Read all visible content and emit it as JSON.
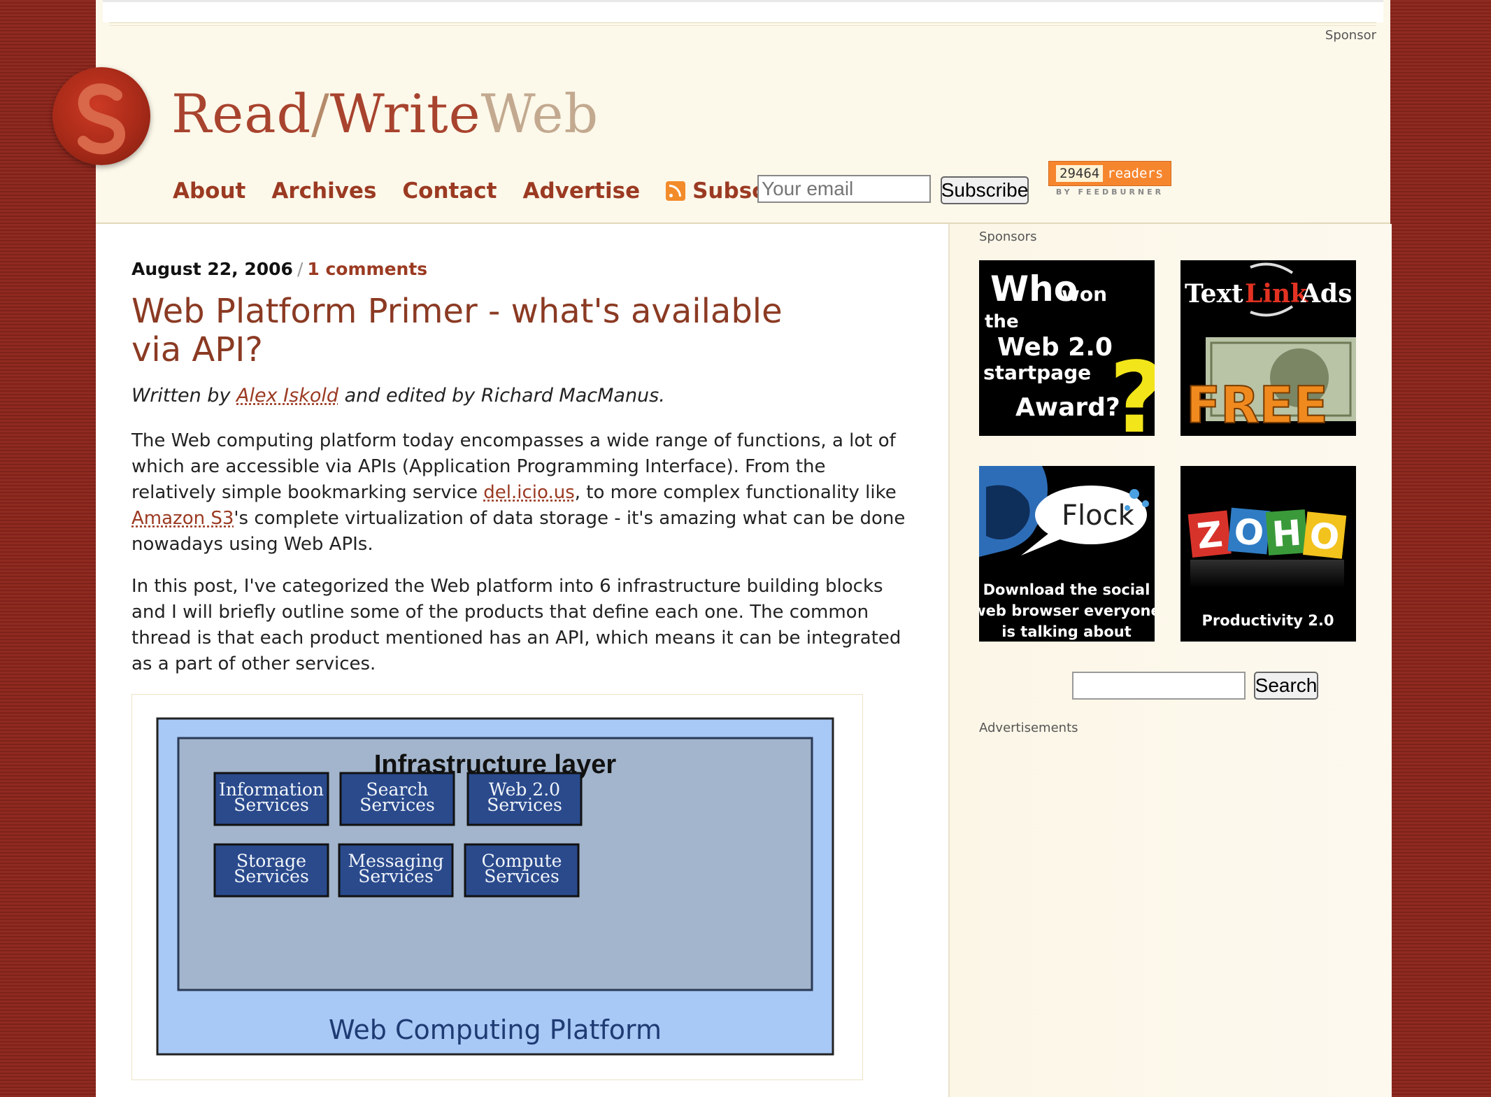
{
  "header": {
    "sponsor_label": "Sponsor",
    "logo": {
      "read_write": "Read/Write",
      "web": "Web",
      "logo_icon": "rww-swirl-logo"
    },
    "nav": [
      "About",
      "Archives",
      "Contact",
      "Advertise",
      "Subscribe"
    ],
    "email_placeholder": "Your email",
    "subscribe_button": "Subscribe",
    "feedburner": {
      "count": "29464",
      "readers_label": "readers",
      "by_label": "BY FEEDBURNER"
    }
  },
  "post": {
    "date": "August 22, 2006",
    "separator": "/",
    "comments": "1 comments",
    "title": "Web Platform Primer - what's available via API?",
    "byline_prefix": "Written by",
    "author": "Alex Iskold",
    "byline_suffix": "and edited by Richard MacManus.",
    "para1_a": "The Web computing platform today encompasses a wide range of functions, a lot of which are accessible via APIs (Application Programming Interface). From the relatively simple bookmarking service ",
    "link1": "del.icio.us",
    "para1_b": ", to more complex functionality like ",
    "link2": "Amazon S3",
    "para1_c": "'s complete virtualization of data storage - it's amazing what can be done nowadays using Web APIs.",
    "para2": "In this post, I've categorized the Web platform into 6 infrastructure building blocks and I will briefly outline some of the products that define each one. The common thread is that each product mentioned has an API, which means it can be integrated as a part of other services."
  },
  "diagram": {
    "layer_title": "Infrastructure layer",
    "platform_label": "Web Computing Platform",
    "blocks": [
      {
        "line1": "Information",
        "line2": "Services"
      },
      {
        "line1": "Search",
        "line2": "Services"
      },
      {
        "line1": "Web 2.0",
        "line2": "Services"
      },
      {
        "line1": "Storage",
        "line2": "Services"
      },
      {
        "line1": "Messaging",
        "line2": "Services"
      },
      {
        "line1": "Compute",
        "line2": "Services"
      }
    ],
    "colors": {
      "outer": "#a8c8f5",
      "inner": "#a3b5cc",
      "block": "#2a4a8c",
      "text": "#1a2b4a"
    }
  },
  "sidebar": {
    "sponsors_label": "Sponsors",
    "ads": [
      {
        "name": "web20-award-ad",
        "line1": "Who",
        "line1b": "won",
        "line2": "the",
        "line3": "Web 2.0",
        "line4": "startpage",
        "line5": "Award?",
        "mark": "?"
      },
      {
        "name": "text-link-ads-ad",
        "text": "Text",
        "link": "Link",
        "ads": "Ads",
        "free": "FREE"
      },
      {
        "name": "flock-ad",
        "brand": "Flock",
        "line1": "Download the social",
        "line2": "web browser everyone",
        "line3": "is talking about"
      },
      {
        "name": "zoho-ad",
        "letters": [
          "Z",
          "O",
          "H",
          "O"
        ],
        "tagline": "Productivity 2.0"
      }
    ],
    "search_button": "Search",
    "advertisements_label": "Advertisements"
  }
}
